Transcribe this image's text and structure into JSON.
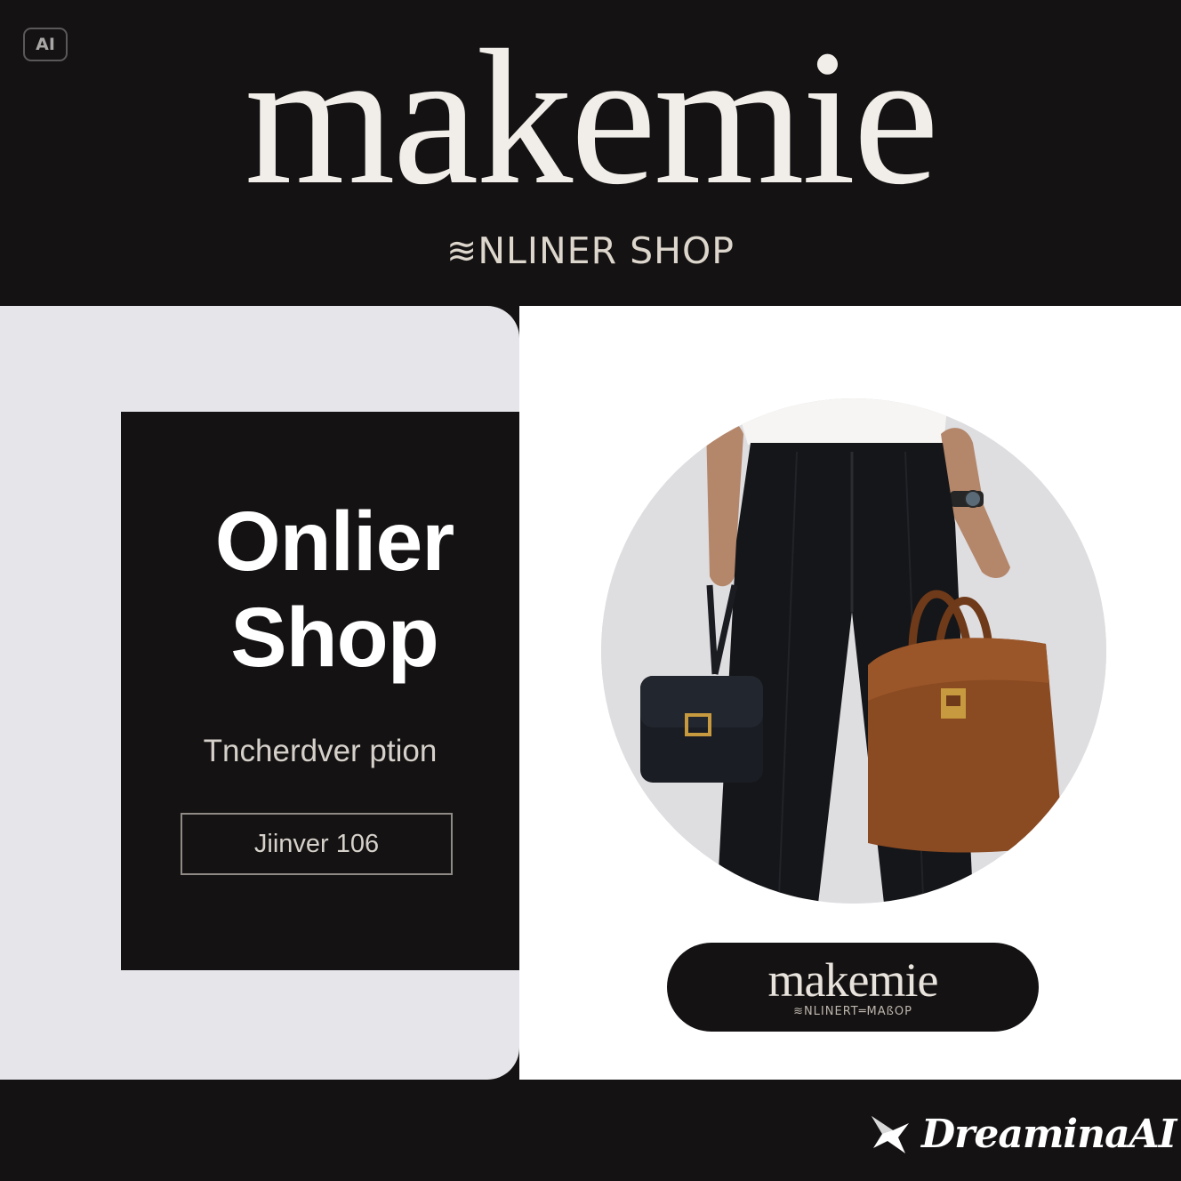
{
  "badge": {
    "label": "AI"
  },
  "header": {
    "brand": "makemie",
    "tagline": "NLINER SHOP",
    "tagline_glyph": "≋"
  },
  "promo": {
    "title_line1": "Onlier",
    "title_line2": "Shop",
    "subtitle": "Tncherdver ption",
    "button_label": "Jiinver 106"
  },
  "product_photo": {
    "subject": "model holding a black shoulder bag and a brown leather tote"
  },
  "logo_pill": {
    "brand": "makemie",
    "tagline": "≋NLINERT═MAßOP"
  },
  "watermark": {
    "text": "DreaminaAI",
    "icon": "dreamina-logo-icon"
  },
  "colors": {
    "background": "#141212",
    "left_panel": "#e6e5ea",
    "right_panel": "#ffffff",
    "text_light": "#f1eeea",
    "tote_brown": "#8a4a22"
  }
}
